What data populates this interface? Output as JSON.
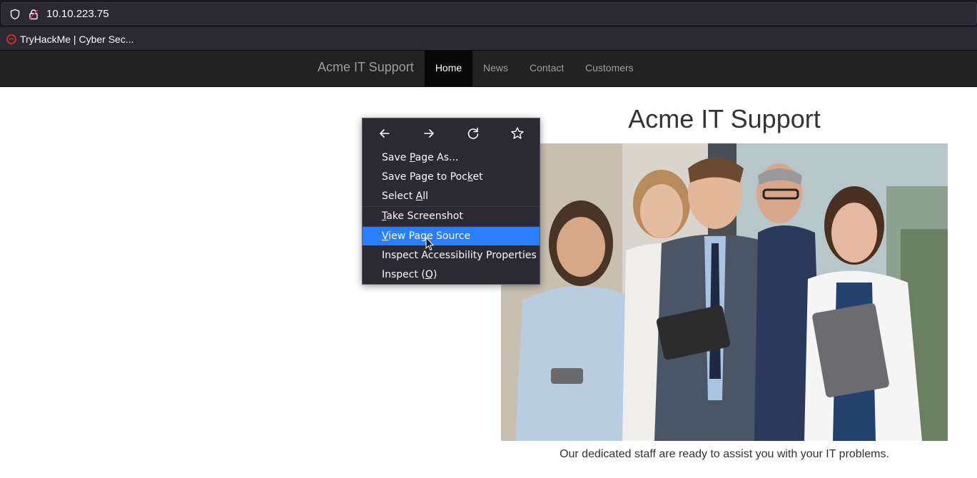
{
  "browser": {
    "url": "10.10.223.75",
    "bookmark": {
      "label": "TryHackMe | Cyber Sec..."
    }
  },
  "site": {
    "brand": "Acme IT Support",
    "nav": [
      {
        "label": "Home",
        "active": true
      },
      {
        "label": "News"
      },
      {
        "label": "Contact"
      },
      {
        "label": "Customers"
      }
    ],
    "title": "Acme IT Support",
    "caption": "Our dedicated staff are ready to assist you with your IT problems."
  },
  "context_menu": {
    "items": [
      {
        "pre": "Save ",
        "key": "P",
        "post": "age As..."
      },
      {
        "pre": "Save Page to Poc",
        "key": "k",
        "post": "et"
      },
      {
        "pre": "Select ",
        "key": "A",
        "post": "ll"
      },
      {
        "pre": "",
        "key": "T",
        "post": "ake Screenshot"
      },
      {
        "pre": "",
        "key": "V",
        "post": "iew Page Source",
        "highlighted": true
      },
      {
        "pre": "Inspect Accessibility Properties",
        "key": "",
        "post": ""
      },
      {
        "pre": "Inspect (",
        "key": "Q",
        "post": ")"
      }
    ]
  },
  "colors": {
    "highlight": "#2a7fff",
    "navbar": "#222222"
  }
}
